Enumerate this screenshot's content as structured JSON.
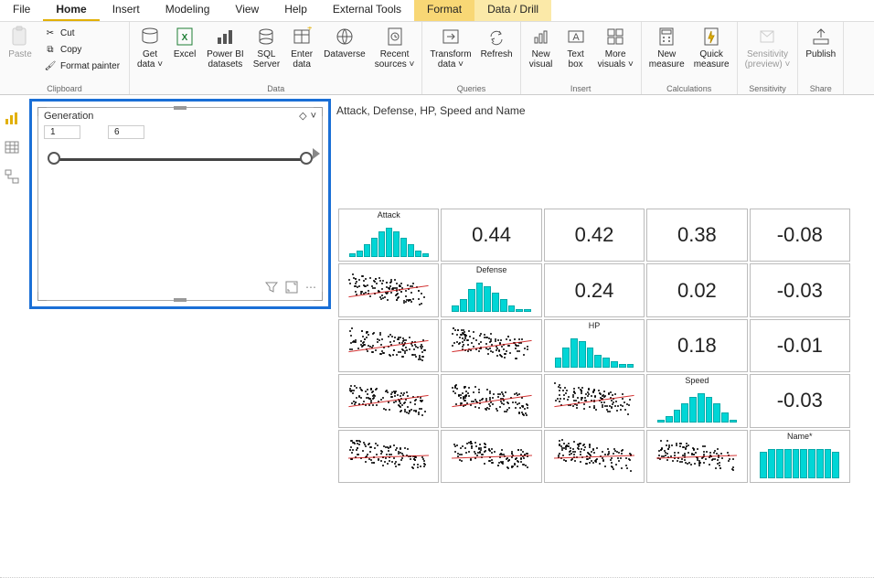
{
  "tabs": {
    "file": "File",
    "home": "Home",
    "insert": "Insert",
    "modeling": "Modeling",
    "view": "View",
    "help": "Help",
    "external": "External Tools",
    "format": "Format",
    "datadrill": "Data / Drill"
  },
  "ribbon": {
    "clipboard": {
      "paste": "Paste",
      "cut": "Cut",
      "copy": "Copy",
      "painter": "Format painter",
      "label": "Clipboard"
    },
    "data": {
      "getdata": "Get\ndata ˅",
      "excel": "Excel",
      "pbidatasets": "Power BI\ndatasets",
      "sqlserver": "SQL\nServer",
      "enterdata": "Enter\ndata",
      "dataverse": "Dataverse",
      "recent": "Recent\nsources ˅",
      "label": "Data"
    },
    "queries": {
      "transform": "Transform\ndata ˅",
      "refresh": "Refresh",
      "label": "Queries"
    },
    "insert": {
      "newvisual": "New\nvisual",
      "textbox": "Text\nbox",
      "morevisuals": "More\nvisuals ˅",
      "label": "Insert"
    },
    "calc": {
      "newmeasure": "New\nmeasure",
      "quickmeasure": "Quick\nmeasure",
      "label": "Calculations"
    },
    "sens": {
      "sensitivity": "Sensitivity\n(preview) ˅",
      "label": "Sensitivity"
    },
    "share": {
      "publish": "Publish",
      "label": "Share"
    }
  },
  "slicer": {
    "title": "Generation",
    "min": "1",
    "max": "6"
  },
  "chart_title": "Attack, Defense, HP, Speed and Name",
  "chart_data": {
    "type": "scatter_matrix",
    "variables": [
      "Attack",
      "Defense",
      "HP",
      "Speed",
      "Name"
    ],
    "correlations": {
      "Attack_Defense": 0.44,
      "Attack_HP": 0.42,
      "Attack_Speed": 0.38,
      "Attack_Name": -0.08,
      "Defense_HP": 0.24,
      "Defense_Speed": 0.02,
      "Defense_Name": -0.03,
      "HP_Speed": 0.18,
      "HP_Name": -0.01,
      "Speed_Name": -0.03
    },
    "diag_labels": {
      "4": "Name*"
    },
    "hist_bins": {
      "Attack": [
        1,
        2,
        4,
        6,
        8,
        9,
        8,
        6,
        4,
        2,
        1
      ],
      "Defense": [
        2,
        4,
        7,
        9,
        8,
        6,
        4,
        2,
        1,
        1
      ],
      "HP": [
        3,
        6,
        9,
        8,
        6,
        4,
        3,
        2,
        1,
        1
      ],
      "Speed": [
        1,
        2,
        4,
        6,
        8,
        9,
        8,
        6,
        3,
        1
      ],
      "Name": [
        8,
        9,
        9,
        9,
        9,
        9,
        9,
        9,
        9,
        8
      ]
    },
    "axis_hint": {
      "x_min": 0,
      "x_max": 200
    }
  },
  "matrix_display": {
    "r0c1": "0.44",
    "r0c2": "0.42",
    "r0c3": "0.38",
    "r0c4": "-0.08",
    "r1c2": "0.24",
    "r1c3": "0.02",
    "r1c4": "-0.03",
    "r2c3": "0.18",
    "r2c4": "-0.01",
    "r3c4": "-0.03"
  }
}
